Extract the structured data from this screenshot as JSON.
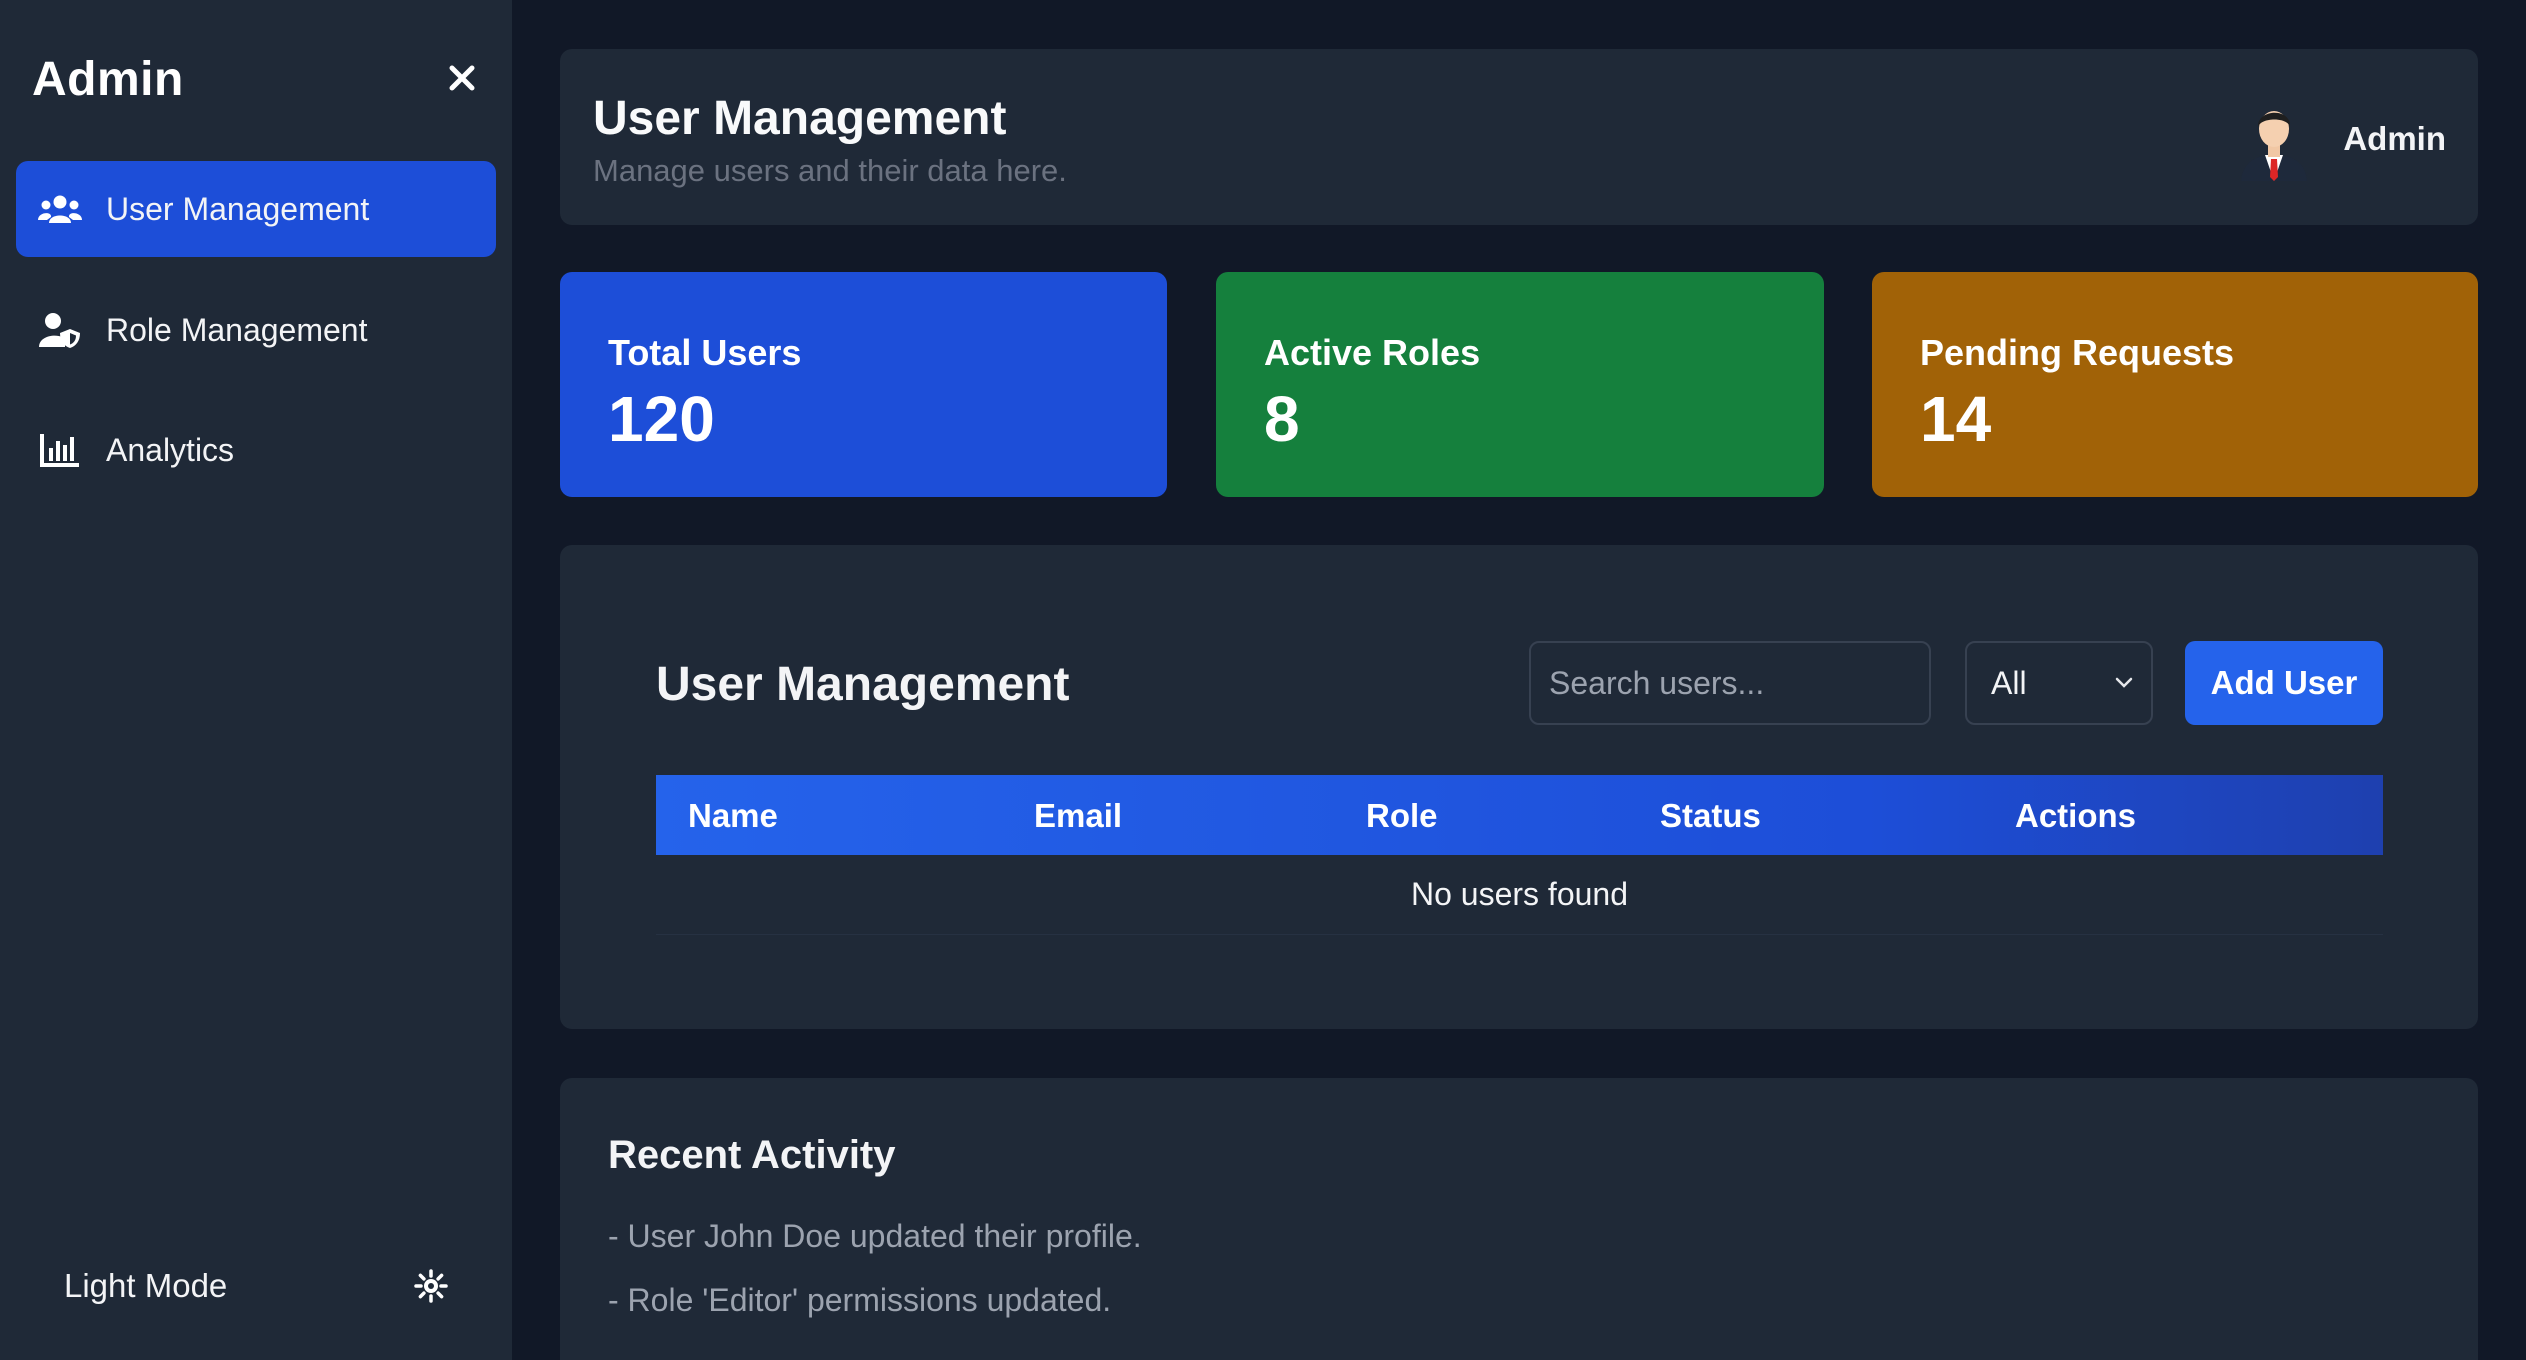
{
  "sidebar": {
    "brand": "Admin",
    "items": [
      {
        "label": "User Management",
        "icon": "users-icon",
        "active": true
      },
      {
        "label": "Role Management",
        "icon": "user-shield-icon",
        "active": false
      },
      {
        "label": "Analytics",
        "icon": "bar-chart-icon",
        "active": false
      }
    ],
    "theme_toggle": {
      "label": "Light Mode",
      "icon": "sun-icon"
    }
  },
  "header": {
    "title": "User Management",
    "subtitle": "Manage users and their data here.",
    "user_name": "Admin"
  },
  "stats": [
    {
      "title": "Total Users",
      "value": "120",
      "color": "#1d4ed8"
    },
    {
      "title": "Active Roles",
      "value": "8",
      "color": "#15803d"
    },
    {
      "title": "Pending Requests",
      "value": "14",
      "color": "#a16207"
    }
  ],
  "users_panel": {
    "title": "User Management",
    "search_placeholder": "Search users...",
    "filter_value": "All",
    "add_button": "Add User",
    "columns": [
      "Name",
      "Email",
      "Role",
      "Status",
      "Actions"
    ],
    "empty_message": "No users found"
  },
  "activity": {
    "title": "Recent Activity",
    "items": [
      "- User John Doe updated their profile.",
      "- Role 'Editor' permissions updated."
    ]
  },
  "colors": {
    "background": "#111827",
    "surface": "#1f2937",
    "accent": "#2563eb"
  }
}
